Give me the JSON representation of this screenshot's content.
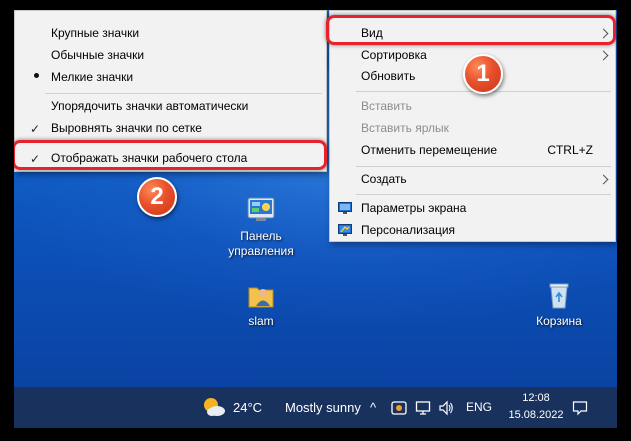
{
  "view_submenu": {
    "items": [
      {
        "label": "Крупные значки"
      },
      {
        "label": "Обычные значки"
      },
      {
        "label": "Мелкие значки"
      },
      {
        "label": "Упорядочить значки автоматически"
      },
      {
        "label": "Выровнять значки по сетке"
      },
      {
        "label": "Отображать значки рабочего стола"
      }
    ]
  },
  "context_menu": {
    "view": "Вид",
    "sort": "Сортировка",
    "refresh": "Обновить",
    "paste": "Вставить",
    "paste_shortcut": "Вставить ярлык",
    "undo_move": "Отменить перемещение",
    "undo_shortcut": "CTRL+Z",
    "create": "Создать",
    "display_settings": "Параметры экрана",
    "personalize": "Персонализация"
  },
  "badges": {
    "one": "1",
    "two": "2"
  },
  "desktop_icons": {
    "control_panel": {
      "line1": "Панель",
      "line2": "управления"
    },
    "user": "slam",
    "recycle": "Корзина"
  },
  "taskbar": {
    "temperature": "24°C",
    "weather": "Mostly sunny",
    "chevron": "^",
    "language": "ENG",
    "time": "12:08",
    "date": "15.08.2022"
  },
  "icons": [
    "check-icon",
    "bullet-icon",
    "chevron-right-icon",
    "monitor-icon",
    "personalize-icon",
    "control-panel-icon",
    "user-folder-icon",
    "recycle-bin-icon",
    "weather-sun-icon",
    "network-icon",
    "volume-icon",
    "notification-icon"
  ],
  "colors": {
    "highlight": "#e8222b",
    "badge": "#e8502a",
    "menu_bg": "#f2f2f2",
    "disabled_text": "#8d8d8d"
  }
}
